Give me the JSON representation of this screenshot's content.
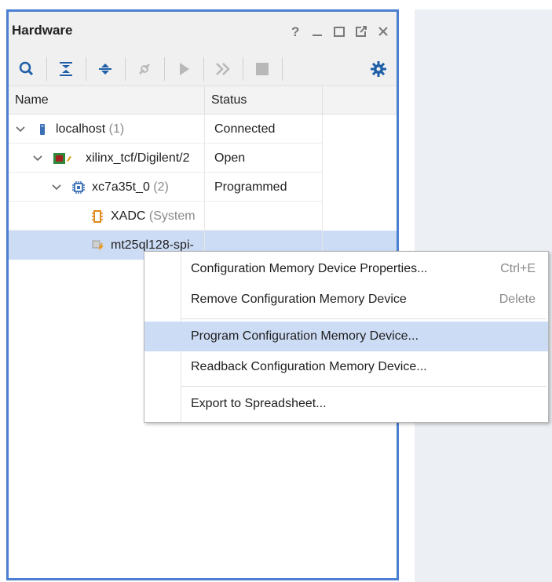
{
  "panel": {
    "title": "Hardware",
    "window_controls": [
      "help-icon",
      "minimize-icon",
      "maximize-icon",
      "float-icon",
      "close-icon"
    ],
    "toolbar_icons": [
      "search-icon",
      "collapse-all-icon",
      "expand-all-icon",
      "auto-connect-icon",
      "run-icon",
      "step-icon",
      "stop-icon",
      "settings-icon"
    ]
  },
  "table": {
    "columns": [
      "Name",
      "Status"
    ],
    "rows": [
      {
        "label": "localhost",
        "count": "(1)",
        "status": "Connected",
        "icon": "server-icon",
        "expanded": true
      },
      {
        "label": "xilinx_tcf/Digilent/2",
        "count": "",
        "status": "Open",
        "icon": "board-icon",
        "expanded": true
      },
      {
        "label": "xc7a35t_0",
        "count": "(2)",
        "status": "Programmed",
        "icon": "chip-icon",
        "expanded": true
      },
      {
        "label": "XADC",
        "count": "(System",
        "status": "",
        "icon": "xadc-icon"
      },
      {
        "label": "mt25ql128-spi-",
        "count": "",
        "status": "",
        "icon": "memory-device-icon",
        "selected": true
      }
    ]
  },
  "context_menu": {
    "items": [
      {
        "label": "Configuration Memory Device Properties...",
        "shortcut": "Ctrl+E"
      },
      {
        "label": "Remove Configuration Memory Device",
        "shortcut": "Delete"
      },
      {
        "label": "Program Configuration Memory Device...",
        "shortcut": "",
        "highlighted": true
      },
      {
        "label": "Readback Configuration Memory Device...",
        "shortcut": ""
      },
      {
        "label": "Export to Spreadsheet...",
        "shortcut": ""
      }
    ]
  },
  "colors": {
    "panel_border": "#4a7fd1",
    "selection": "#cddcf5",
    "toolbar_icon_blue": "#1f5fa8"
  }
}
